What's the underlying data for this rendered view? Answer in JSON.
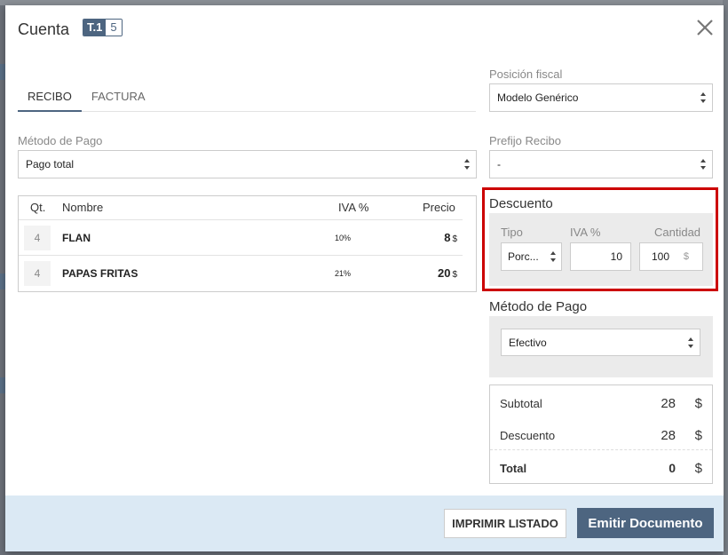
{
  "modal": {
    "title": "Cuenta",
    "table_label": "T.1",
    "table_count": "5"
  },
  "tabs": [
    {
      "label": "RECIBO",
      "active": true
    },
    {
      "label": "FACTURA",
      "active": false
    }
  ],
  "left": {
    "metodo_label": "Método de Pago",
    "metodo_value": "Pago total"
  },
  "right": {
    "posicion_label": "Posición fiscal",
    "posicion_value": "Modelo Genérico",
    "prefijo_label": "Prefijo Recibo",
    "prefijo_value": "-"
  },
  "products": {
    "headers": {
      "qty": "Qt.",
      "name": "Nombre",
      "iva": "IVA %",
      "price": "Precio"
    },
    "rows": [
      {
        "qty": "4",
        "name": "FLAN",
        "iva": "10%",
        "price": "8",
        "currency": "$"
      },
      {
        "qty": "4",
        "name": "PAPAS FRITAS",
        "iva": "21%",
        "price": "20",
        "currency": "$"
      }
    ]
  },
  "descuento": {
    "title": "Descuento",
    "tipo_label": "Tipo",
    "iva_label": "IVA %",
    "cantidad_label": "Cantidad",
    "tipo_value": "Porc...",
    "iva_value": "10",
    "cantidad_value": "100",
    "currency": "$"
  },
  "pago": {
    "title": "Método de Pago",
    "value": "Efectivo"
  },
  "totals": {
    "subtotal_label": "Subtotal",
    "subtotal_value": "28",
    "descuento_label": "Descuento",
    "descuento_value": "28",
    "total_label": "Total",
    "total_value": "0",
    "currency": "$"
  },
  "footer": {
    "print_label": "IMPRIMIR LISTADO",
    "emit_label": "Emitir Documento"
  },
  "colors": {
    "accent": "#4d6580",
    "highlight": "#cc0000",
    "footer_bg": "#dbe9f4"
  }
}
